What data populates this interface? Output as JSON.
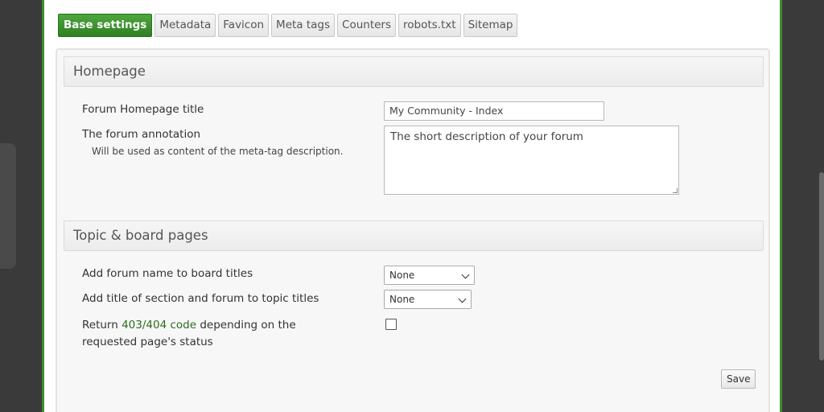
{
  "tabs": [
    {
      "label": "Base settings"
    },
    {
      "label": "Metadata"
    },
    {
      "label": "Favicon"
    },
    {
      "label": "Meta tags"
    },
    {
      "label": "Counters"
    },
    {
      "label": "robots.txt"
    },
    {
      "label": "Sitemap"
    }
  ],
  "homepage": {
    "heading": "Homepage",
    "title_label": "Forum Homepage title",
    "title_value": "My Community - Index",
    "annotation_label": "The forum annotation",
    "annotation_hint": "Will be used as content of the meta-tag description.",
    "annotation_value": "The short description of your forum"
  },
  "topic": {
    "heading": "Topic & board pages",
    "board_title_label": "Add forum name to board titles",
    "board_title_value": "None",
    "topic_title_label": "Add title of section and forum to topic titles",
    "topic_title_value": "None",
    "return_label_pre": "Return ",
    "return_label_code": "403/404 code",
    "return_label_post": " depending on the requested page's status"
  },
  "actions": {
    "save_label": "Save"
  },
  "colors": {
    "accent": "#3e8e2f",
    "active_tab": "#3a9430"
  }
}
